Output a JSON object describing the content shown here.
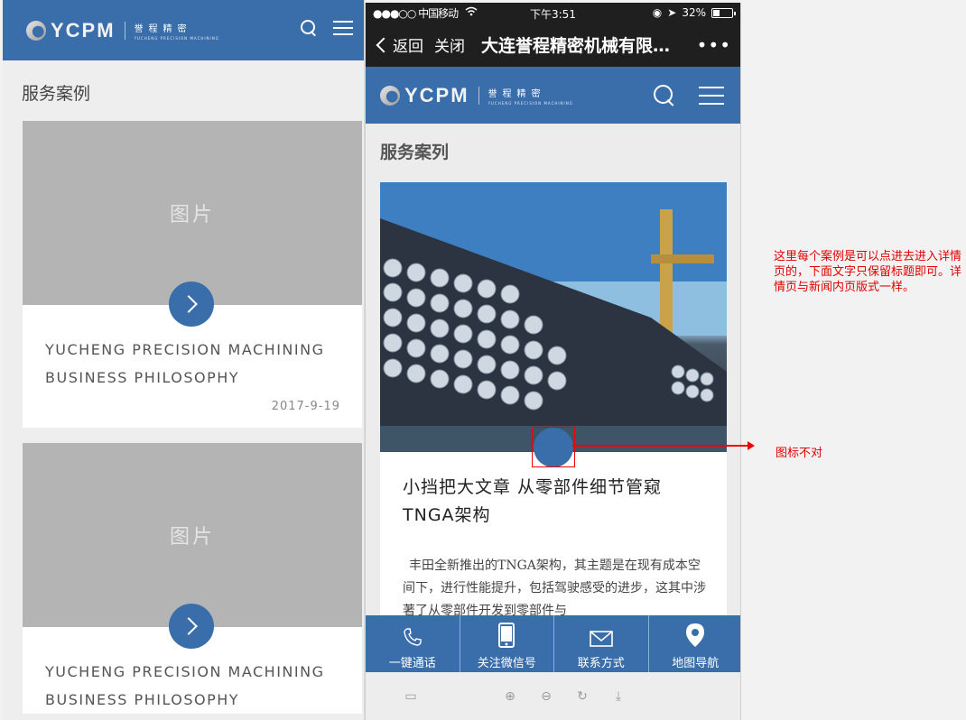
{
  "left": {
    "logo_text": "YCPM",
    "logo_cn": "誉程精密",
    "logo_en": "YUCHENG PRECISION MACHINING",
    "section_title": "服务案例",
    "cards": [
      {
        "image_placeholder": "图片",
        "title": "YUCHENG PRECISION MACHINING BUSINESS PHILOSOPHY",
        "date": "2017-9-19"
      },
      {
        "image_placeholder": "图片",
        "title": "YUCHENG PRECISION MACHINING BUSINESS PHILOSOPHY",
        "date": ""
      }
    ]
  },
  "phone": {
    "status": {
      "carrier": "●●●○○ 中国移动",
      "time": "下午3:51",
      "battery": "32%"
    },
    "nav": {
      "back": "返回",
      "close": "关闭",
      "title": "大连誉程精密机械有限…",
      "more": "•••"
    },
    "section_title": "服务案列",
    "article": {
      "title": "小挡把大文章 从零部件细节管窥TNGA架构",
      "excerpt": "丰田全新推出的TNGA架构，其主题是在现有成本空间下，进行性能提升，包括驾驶感受的进步，这其中涉著了从零部件开发到零部件与"
    },
    "bottom_bar": [
      {
        "label": "一键通话",
        "icon": "phone-icon"
      },
      {
        "label": "关注微信号",
        "icon": "mobile-icon"
      },
      {
        "label": "联系方式",
        "icon": "mail-icon"
      },
      {
        "label": "地图导航",
        "icon": "location-pin-icon"
      }
    ]
  },
  "annotations": {
    "note_cases": "这里每个案例是可以点进去进入详情页的，下面文字只保留标题即可。详情页与新闻内页版式一样。",
    "note_icon": "图标不对"
  },
  "colors": {
    "brand_blue": "#3a6eab",
    "annotation_red": "#e00000"
  }
}
